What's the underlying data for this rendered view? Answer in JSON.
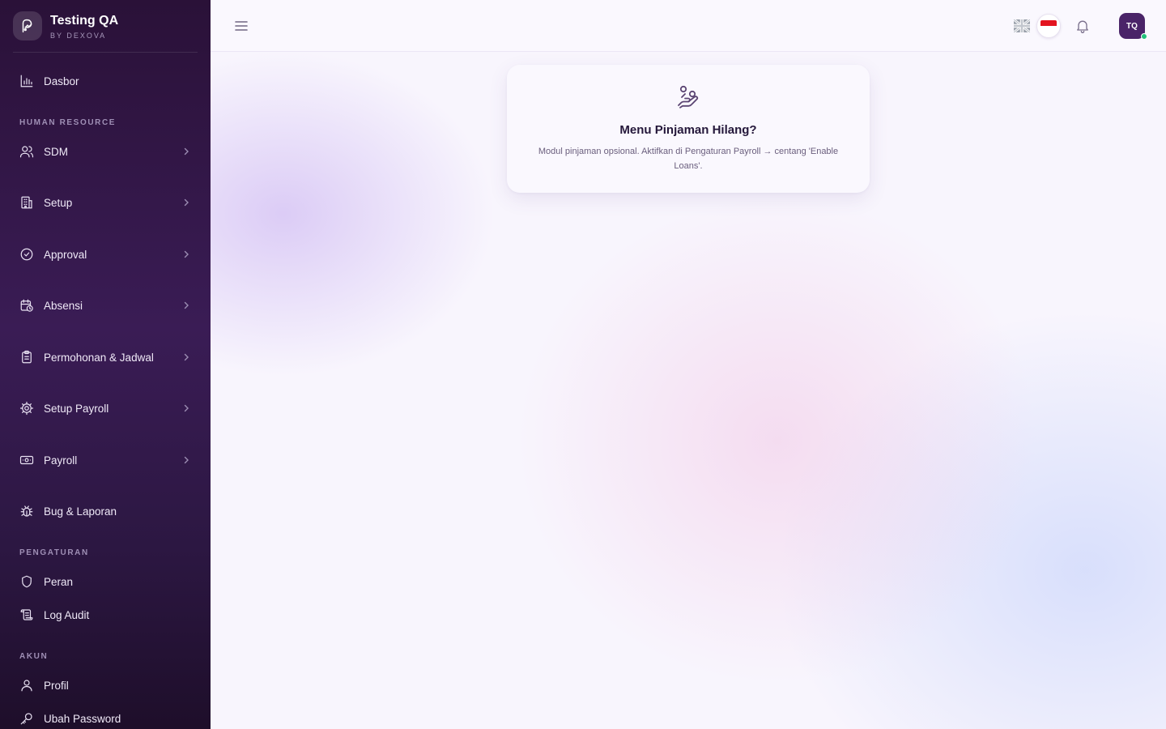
{
  "brand": {
    "name": "Testing QA",
    "subtitle": "BY DEXOVA"
  },
  "sidebar": {
    "items": [
      {
        "label": "Dasbor",
        "icon": "bar-chart-icon"
      },
      {
        "section": "HUMAN RESOURCE"
      },
      {
        "label": "SDM",
        "icon": "users-icon",
        "has_submenu": true
      },
      {
        "label": "Setup",
        "icon": "building-icon",
        "has_submenu": true
      },
      {
        "label": "Approval",
        "icon": "check-circle-icon",
        "has_submenu": true
      },
      {
        "label": "Absensi",
        "icon": "calendar-clock-icon",
        "has_submenu": true
      },
      {
        "label": "Permohonan & Jadwal",
        "icon": "clipboard-icon",
        "has_submenu": true
      },
      {
        "label": "Setup Payroll",
        "icon": "gear-icon",
        "has_submenu": true
      },
      {
        "label": "Payroll",
        "icon": "banknote-icon",
        "has_submenu": true
      },
      {
        "label": "Bug & Laporan",
        "icon": "bug-icon"
      },
      {
        "section": "PENGATURAN"
      },
      {
        "label": "Peran",
        "icon": "shield-icon"
      },
      {
        "label": "Log Audit",
        "icon": "scroll-icon"
      },
      {
        "section": "AKUN"
      },
      {
        "label": "Profil",
        "icon": "user-icon"
      },
      {
        "label": "Ubah Password",
        "icon": "key-icon"
      }
    ]
  },
  "topbar": {
    "language_options": [
      "en",
      "id"
    ],
    "selected_language": "id",
    "avatar_initials": "TQ",
    "online_status_color": "#21c27a"
  },
  "card": {
    "icon": "hand-coins-icon",
    "title": "Menu Pinjaman Hilang?",
    "description": "Modul pinjaman opsional. Aktifkan di Pengaturan Payroll → centang 'Enable Loans'."
  },
  "colors": {
    "sidebar_bg": "#2a1138",
    "accent": "#4a2468",
    "card_title": "#24173a"
  }
}
